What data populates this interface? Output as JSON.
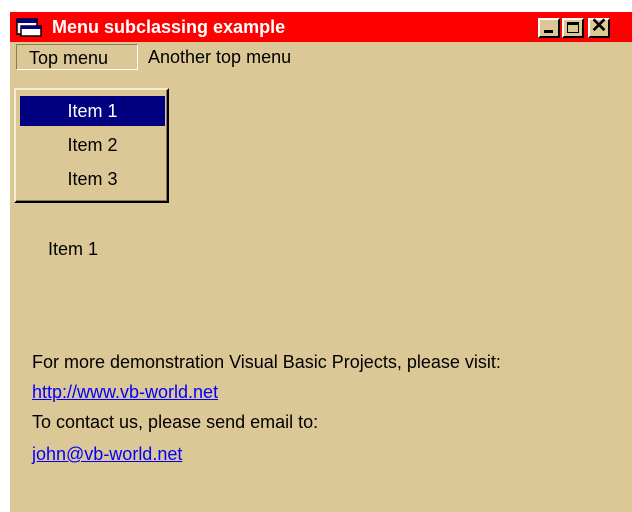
{
  "window": {
    "title": "Menu subclassing example",
    "controls": {
      "minimize_icon": "minimize-icon",
      "maximize_icon": "maximize-icon",
      "close_label": "✕"
    },
    "colors": {
      "titlebar": "#ff0000",
      "background": "#dcc896",
      "selection": "#000080",
      "link": "#0000ff"
    }
  },
  "menubar": {
    "items": [
      {
        "label": "Top menu",
        "open": true
      },
      {
        "label": "Another top menu",
        "open": false
      }
    ]
  },
  "dropdown": {
    "items": [
      {
        "label": "Item 1",
        "selected": true
      },
      {
        "label": "Item 2",
        "selected": false
      },
      {
        "label": "Item 3",
        "selected": false
      }
    ]
  },
  "content": {
    "selected_item_label": "Item 1",
    "info_text": "For more demonstration Visual Basic Projects, please visit:",
    "website_link": "http://www.vb-world.net",
    "contact_text": "To contact us, please send email to:",
    "email_link": "john@vb-world.net"
  }
}
